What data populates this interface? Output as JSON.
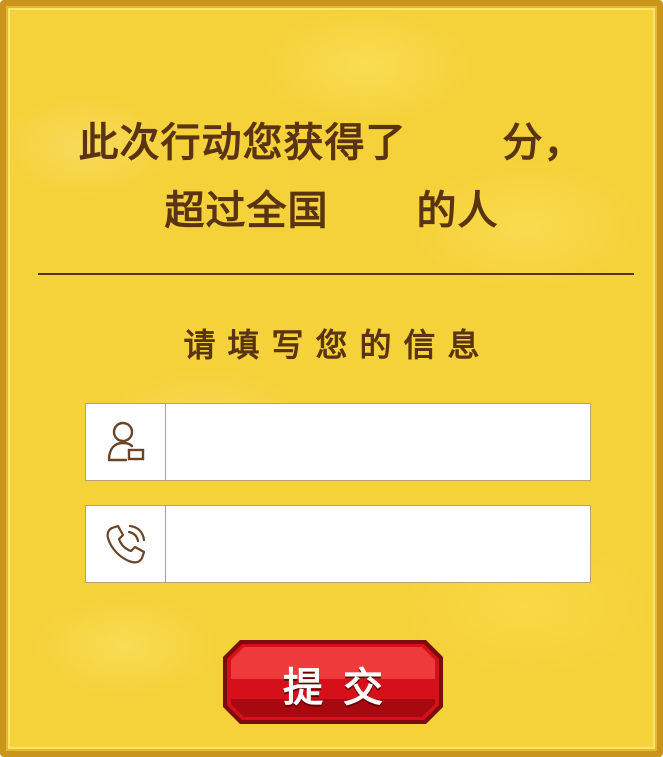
{
  "result": {
    "line1_prefix": "此次行动您获得了",
    "line1_score": "",
    "line1_suffix": "分，",
    "line2_prefix": "超过全国",
    "line2_percent": "",
    "line2_suffix": "的人"
  },
  "form": {
    "title": "请填写您的信息",
    "name_field": {
      "icon": "user-icon",
      "value": "",
      "placeholder": ""
    },
    "phone_field": {
      "icon": "phone-icon",
      "value": "",
      "placeholder": ""
    }
  },
  "submit": {
    "label": "提交"
  },
  "colors": {
    "panel_bg": "#f6d23a",
    "panel_border": "#c9951c",
    "text": "#5a3312",
    "button_red": "#d6101a"
  }
}
